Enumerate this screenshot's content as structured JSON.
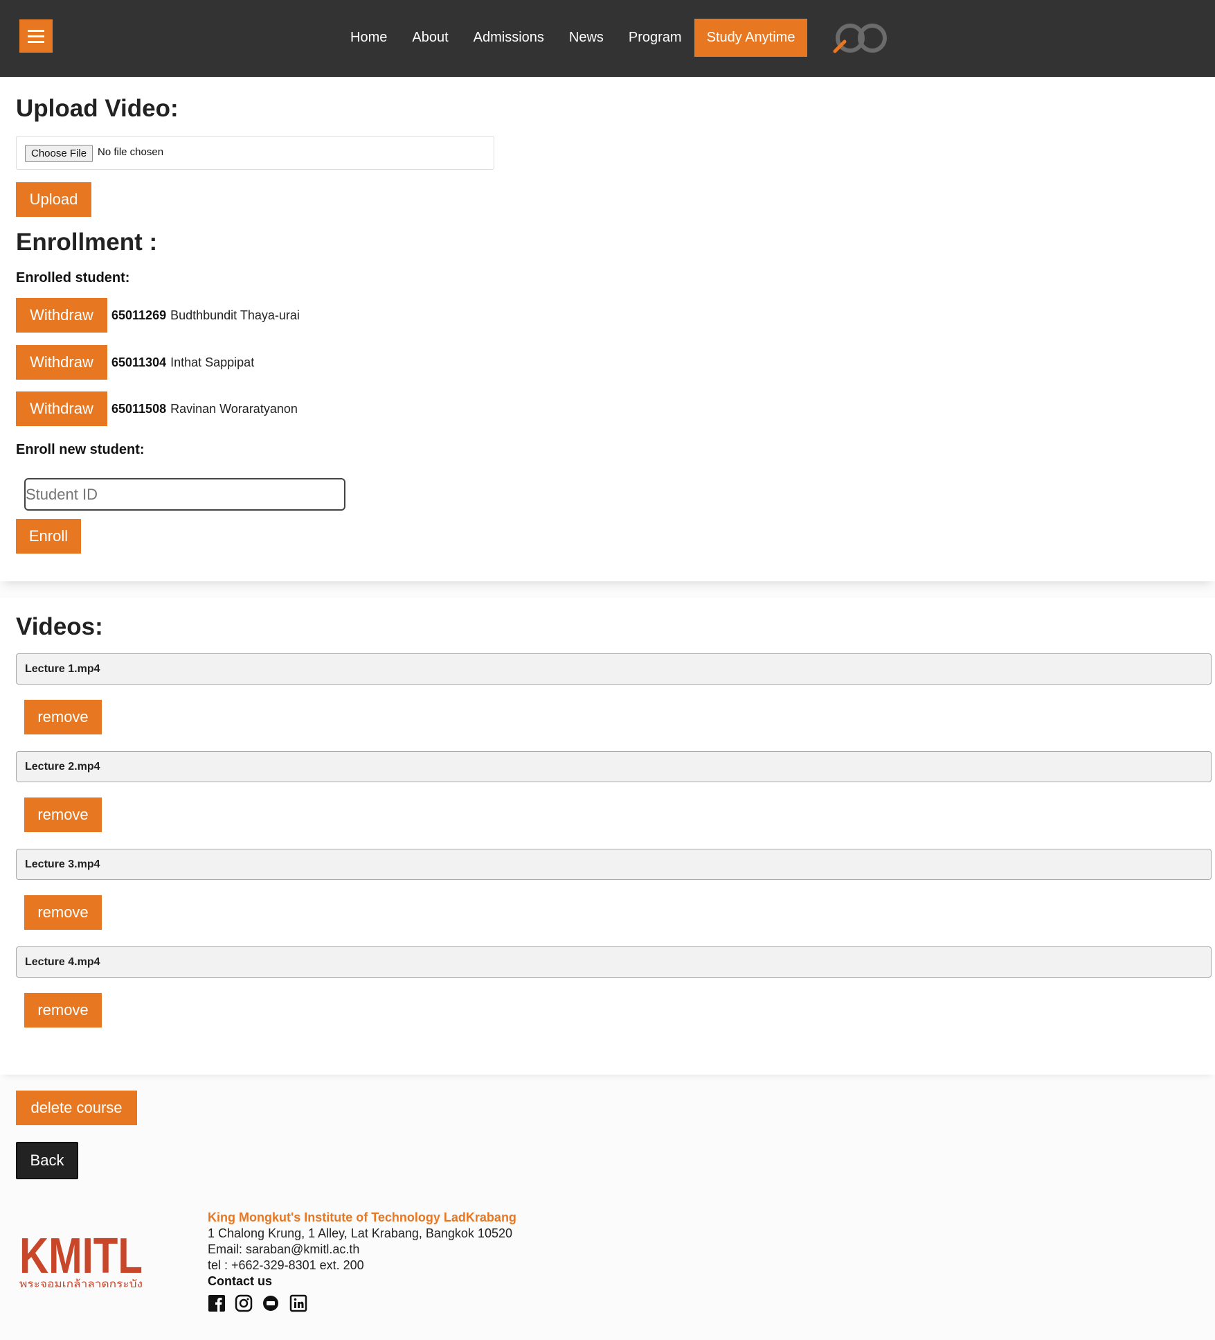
{
  "nav": {
    "links": [
      "Home",
      "About",
      "Admissions",
      "News",
      "Program"
    ],
    "active": "Study Anytime"
  },
  "upload": {
    "title": "Upload Video:",
    "choose_label": "Choose File",
    "file_status": "No file chosen",
    "upload_label": "Upload"
  },
  "enrollment": {
    "title": "Enrollment :",
    "enrolled_label": "Enrolled student:",
    "withdraw_label": "Withdraw",
    "students": [
      {
        "id": "65011269",
        "name": "Budthbundit Thaya-urai"
      },
      {
        "id": "65011304",
        "name": "Inthat Sappipat"
      },
      {
        "id": "65011508",
        "name": "Ravinan Woraratyanon"
      }
    ],
    "enroll_new_label": "Enroll new student:",
    "input_placeholder": "Student ID",
    "enroll_button": "Enroll"
  },
  "videos": {
    "title": "Videos:",
    "remove_label": "remove",
    "items": [
      "Lecture 1.mp4",
      "Lecture 2.mp4",
      "Lecture 3.mp4",
      "Lecture 4.mp4"
    ]
  },
  "actions": {
    "delete_course": "delete course",
    "back": "Back"
  },
  "footer": {
    "logo_text": "KMITL",
    "logo_subtext": "พระจอมเกล้าลาดกระบัง",
    "institute": "King Mongkut's Institute of Technology LadKrabang",
    "address": "1 Chalong Krung, 1 Alley, Lat Krabang, Bangkok 10520",
    "email": "Email: saraban@kmitl.ac.th",
    "tel": "tel : +662-329-8301 ext. 200",
    "contact": "Contact us",
    "social_icons": [
      "facebook-icon",
      "instagram-icon",
      "line-icon",
      "linkedin-icon"
    ]
  },
  "colors": {
    "accent": "#e87722",
    "navbar": "#333333"
  }
}
